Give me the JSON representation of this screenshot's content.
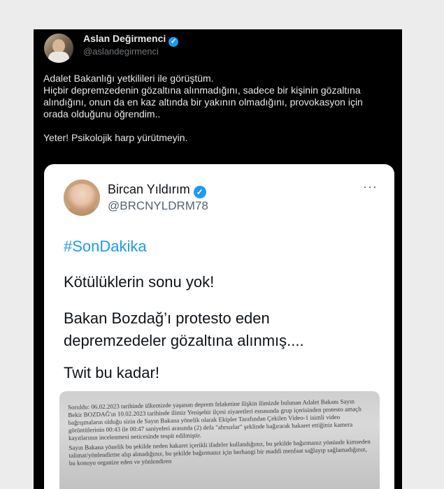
{
  "outer_tweet": {
    "author_name": "Aslan Değirmenci",
    "author_handle": "@aslandegirmenci",
    "text_lines": [
      "Adalet Bakanlığı yetkilileri ile görüştüm.",
      "Hiçbir depremzedenin gözaltına alınmadığını, sadece bir kişinin gözaltına",
      "alındığını, onun da en kaz altında bir yakının olmadığını, provokasyon için",
      "orada olduğunu öğrendim..",
      "",
      "Yeter! Psikolojik harp yürütmeyin."
    ]
  },
  "quoted_tweet": {
    "author_name": "Bircan Yıldırım",
    "author_handle": "@BRCNYLDRM78",
    "hashtag": "#SonDakika",
    "line1": "Kötülüklerin sonu yok!",
    "line2": "Bakan Bozdağ’ı protesto eden",
    "line3": "depremzedeler gözaltına alınmış....",
    "line4": "Twit bu kadar!",
    "more_label": "···",
    "document_paragraphs": [
      "Soruldu: 06.02.2023 tarihinde ülkemizde yaşanan deprem felaketine ilişkin ilimizde bulunan Adalet Bakanı Sayın Bekir BOZDAĞ'ın 10.02.2023 tarihinde ilimiz Yenişehir ilçesi ziyaretleri esnasında grup içerisinden protesto amaçlı bağrışmaların olduğu sizin de Sayın Bakana yönelik olarak Ekipler Tarafından Çekilen Video-1 isimli video görüntülerinin 00:43 ile 00:47 saniyeleri arasında (2) defa \"ahrsızlar\" şeklinde bağırarak hakaret ettiğiniz kamera kayıtlarının incelenmesi neticesinde tespit edilmiştir.",
      "Sayın Bakana yönelik bu şekilde neden hakaret içerikli ifadeler kullandığınız, bu şekilde bağırmanız yönünde kimseden talimat/yönlendirme alıp almadığınız, bu şekilde bağırmanız için herhangi bir maddi menfaat sağlayıp sağlamadığınız, bu konuyu organize eden ve yönlendiren"
    ]
  },
  "colors": {
    "page_background": "#ececec",
    "outer_background": "#000000",
    "card_background": "#ffffff",
    "accent": "#1d9bf0"
  }
}
